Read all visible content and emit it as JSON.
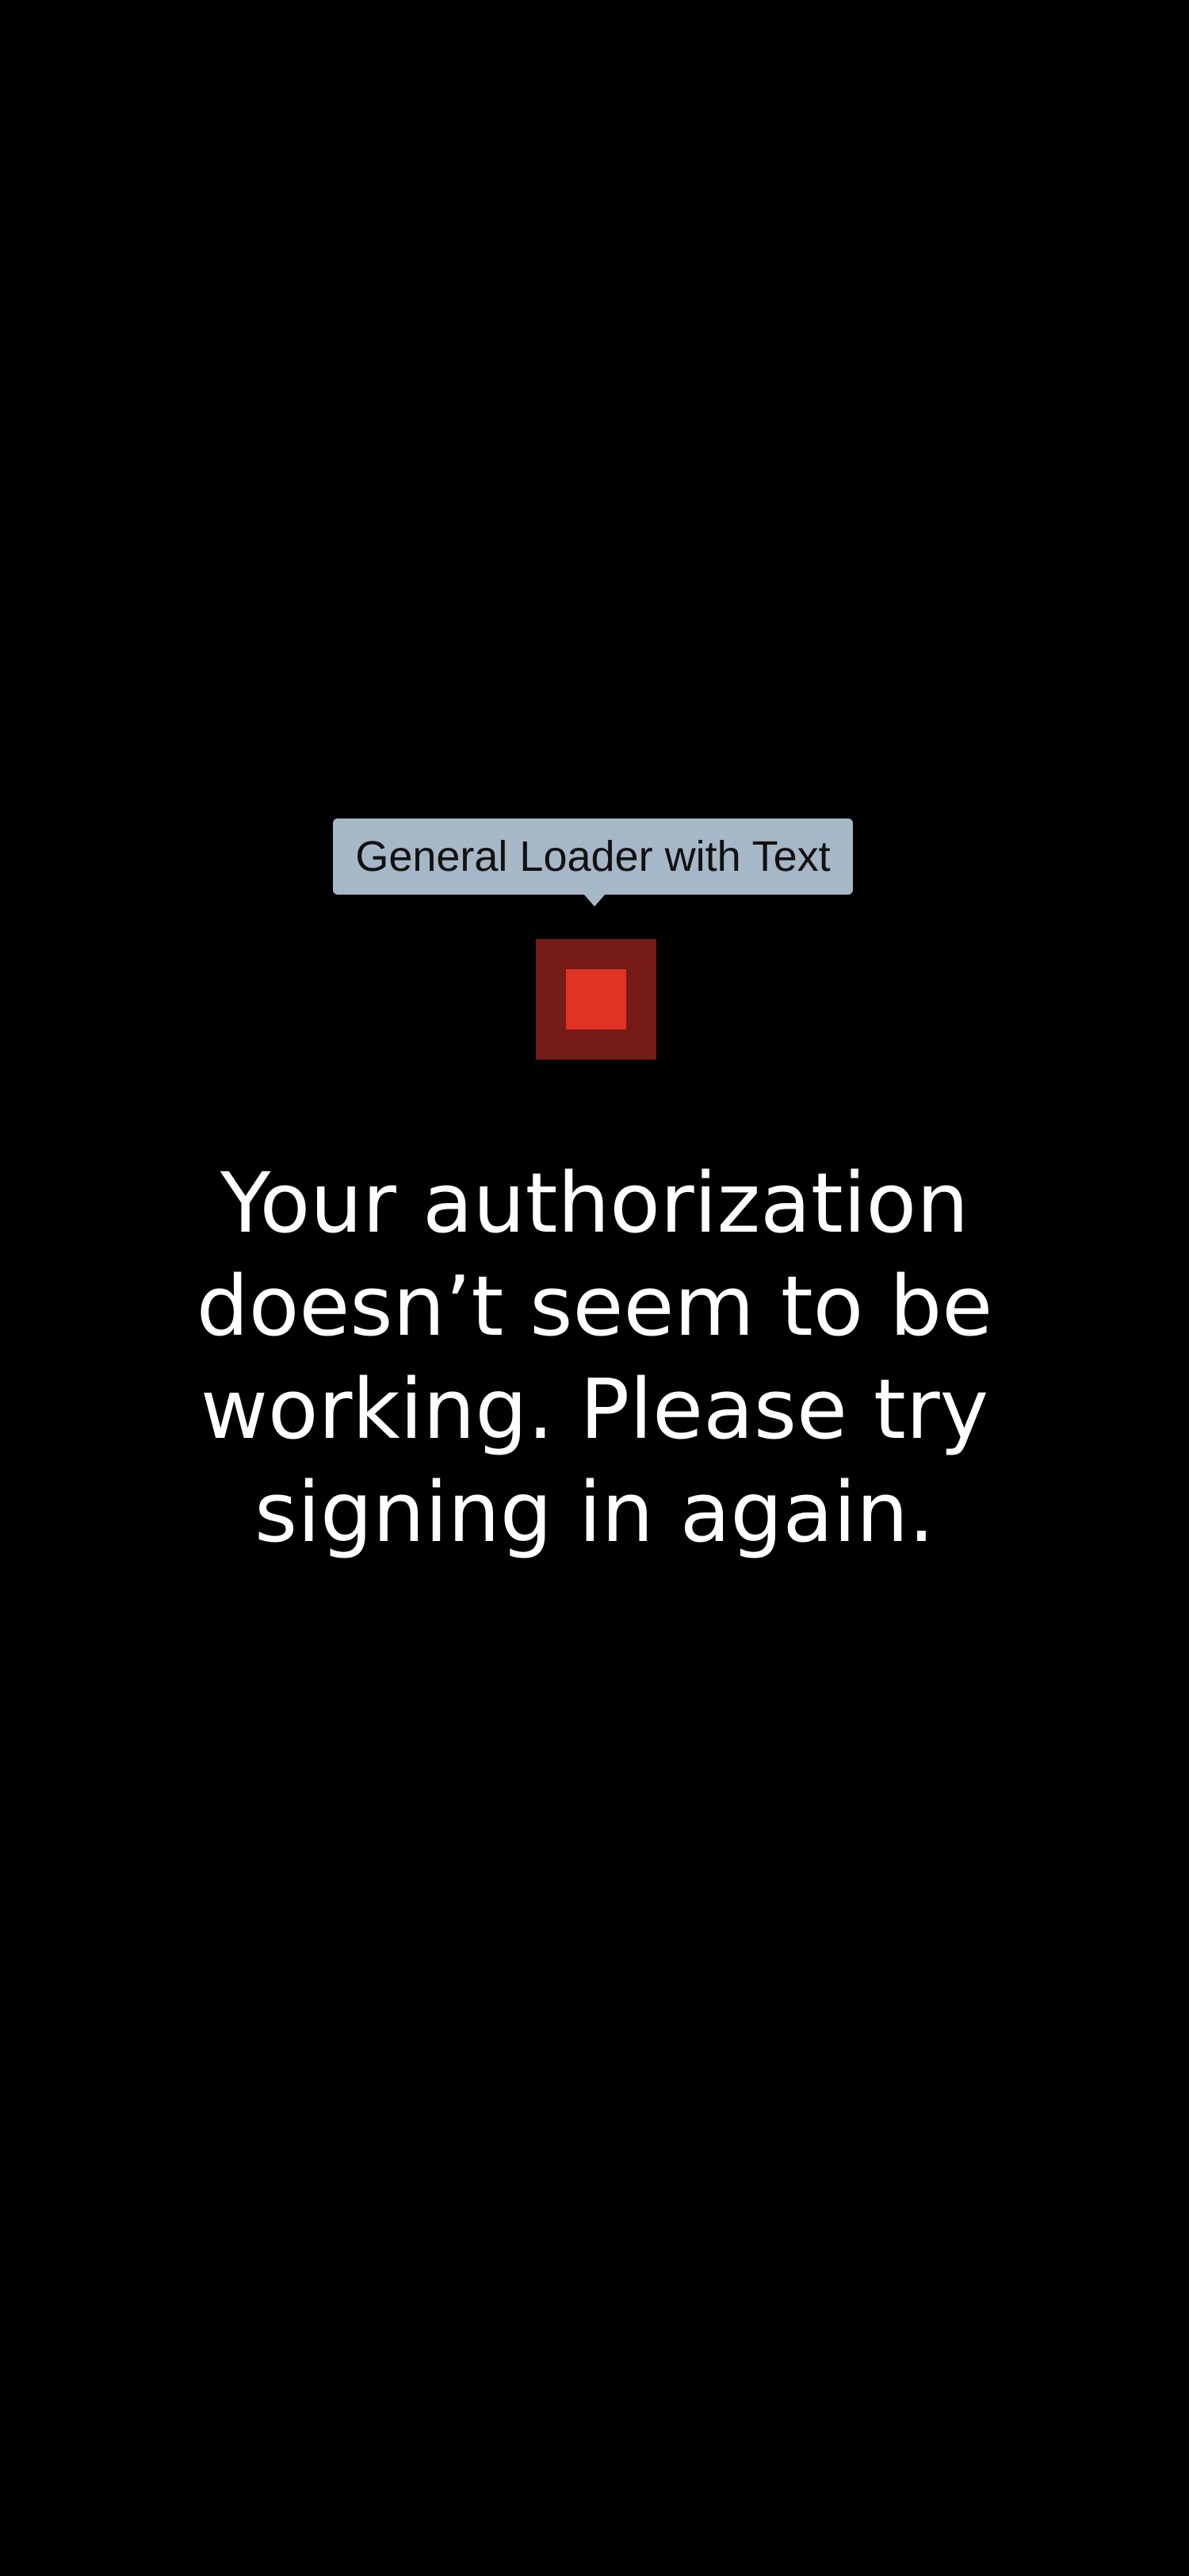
{
  "loader": {
    "tooltip_label": "General Loader with Text",
    "icon": "square-loader-icon",
    "colors": {
      "tooltip_background": "#a6b7c7",
      "outer_square": "#761b16",
      "inner_square": "#e03324"
    }
  },
  "message": {
    "text": "Your authorization doesn’t seem to be working. Please try signing in again."
  },
  "colors": {
    "background": "#000000",
    "message_text": "#ffffff"
  }
}
